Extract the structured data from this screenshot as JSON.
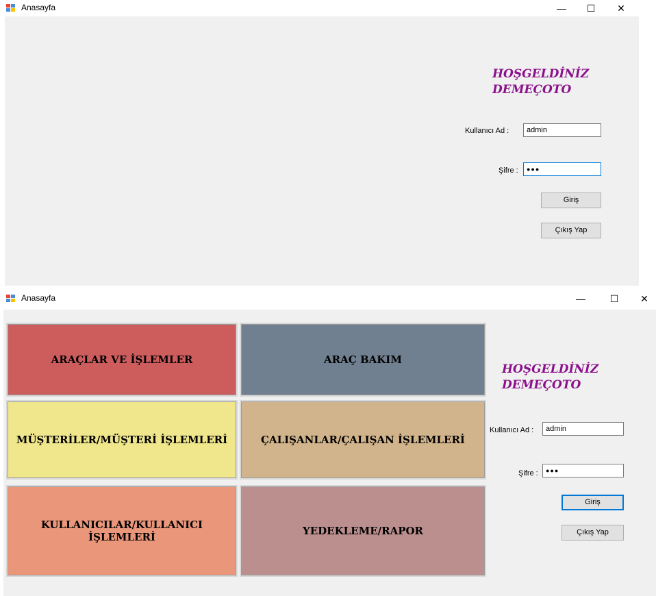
{
  "window1": {
    "title": "Anasayfa",
    "welcome_line1": "HOŞGELDİNİZ",
    "welcome_line2": "DEMEÇOTO",
    "username_label": "Kullanıcı Ad :",
    "username_value": "admin",
    "password_label": "Şifre :",
    "password_value": "●●●",
    "login_button": "Giriş",
    "exit_button": "Çıkış Yap",
    "minimize_glyph": "—",
    "maximize_glyph": "☐",
    "close_glyph": "✕"
  },
  "window2": {
    "title": "Anasayfa",
    "welcome_line1": "HOŞGELDİNİZ",
    "welcome_line2": "DEMEÇOTO",
    "username_label": "Kullanıcı Ad :",
    "username_value": "admin",
    "password_label": "Şifre :",
    "password_value": "●●●",
    "login_button": "Giriş",
    "exit_button": "Çıkış Yap",
    "minimize_glyph": "—",
    "maximize_glyph": "☐",
    "close_glyph": "✕",
    "tiles": [
      {
        "label": "ARAÇLAR VE  İŞLEMLER",
        "color": "#cd5c5c"
      },
      {
        "label": "ARAÇ BAKIM",
        "color": "#708090"
      },
      {
        "label": "MÜŞTERİLER/MÜŞTERİ İŞLEMLERİ",
        "color": "#f0e68c"
      },
      {
        "label": "ÇALIŞANLAR/ÇALIŞAN İŞLEMLERİ",
        "color": "#d2b48c"
      },
      {
        "label": "KULLANICILAR/KULLANICI İŞLEMLERİ",
        "color": "#e9967a"
      },
      {
        "label": "YEDEKLEME/RAPOR",
        "color": "#bc8f8f"
      }
    ]
  },
  "icon": "windows-form-icon",
  "colors": {
    "client_bg": "#f0f0f0",
    "welcome_text": "#8b108b",
    "focus_border": "#0078d7"
  }
}
